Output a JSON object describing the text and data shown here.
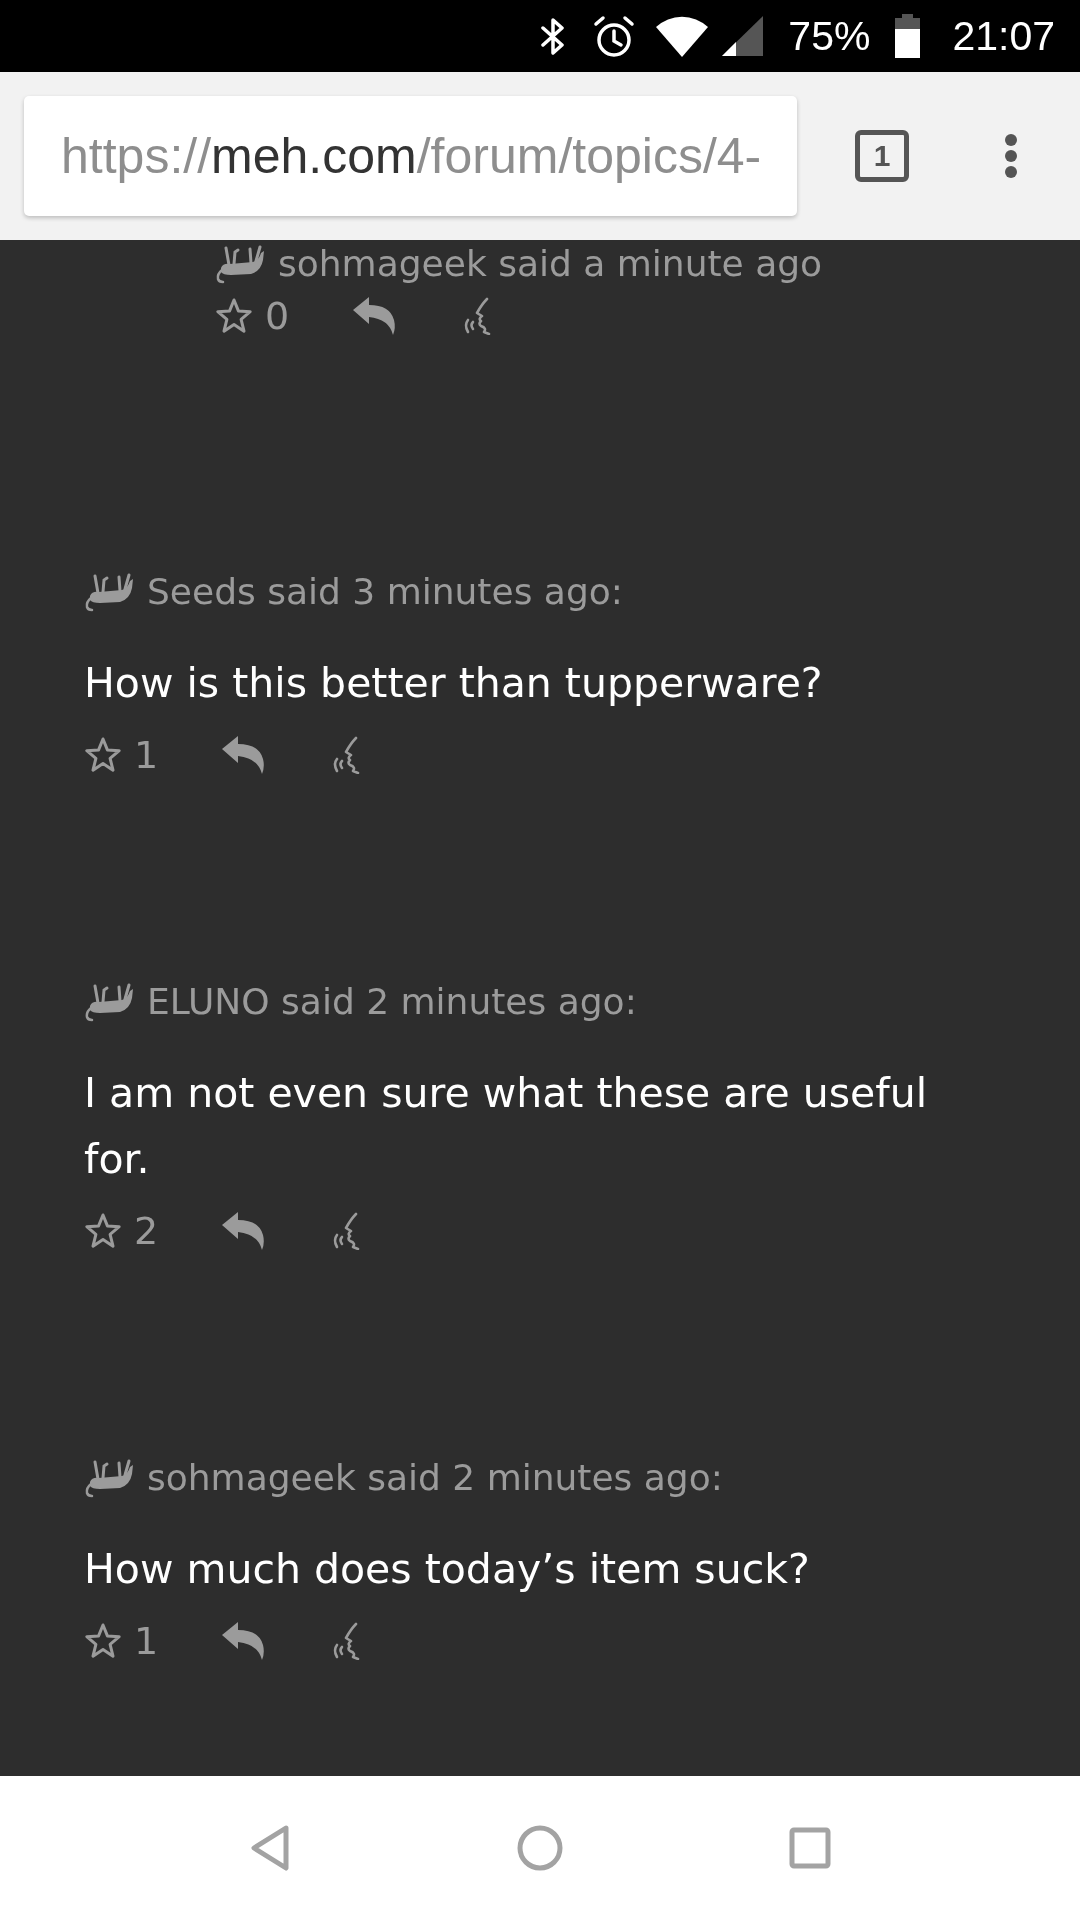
{
  "status_bar": {
    "battery": "75%",
    "time": "21:07"
  },
  "toolbar": {
    "url": {
      "scheme": "https://",
      "domain": "meh.com",
      "path": "/forum/topics/4-"
    },
    "tab_count": "1"
  },
  "comments": [
    {
      "kind": "reply",
      "header": "sohmageek said a minute ago",
      "star_count": "0"
    },
    {
      "kind": "comment",
      "header": "Seeds said 3 minutes ago:",
      "body": "How is this better than tupperware?",
      "star_count": "1"
    },
    {
      "kind": "comment",
      "header": "ELUNO said 2 minutes ago:",
      "body": "I am not even sure what these are useful for.",
      "star_count": "2"
    },
    {
      "kind": "comment",
      "header": "sohmageek said 2 minutes ago:",
      "body": "How much does today’s item suck?",
      "star_count": "1"
    }
  ]
}
